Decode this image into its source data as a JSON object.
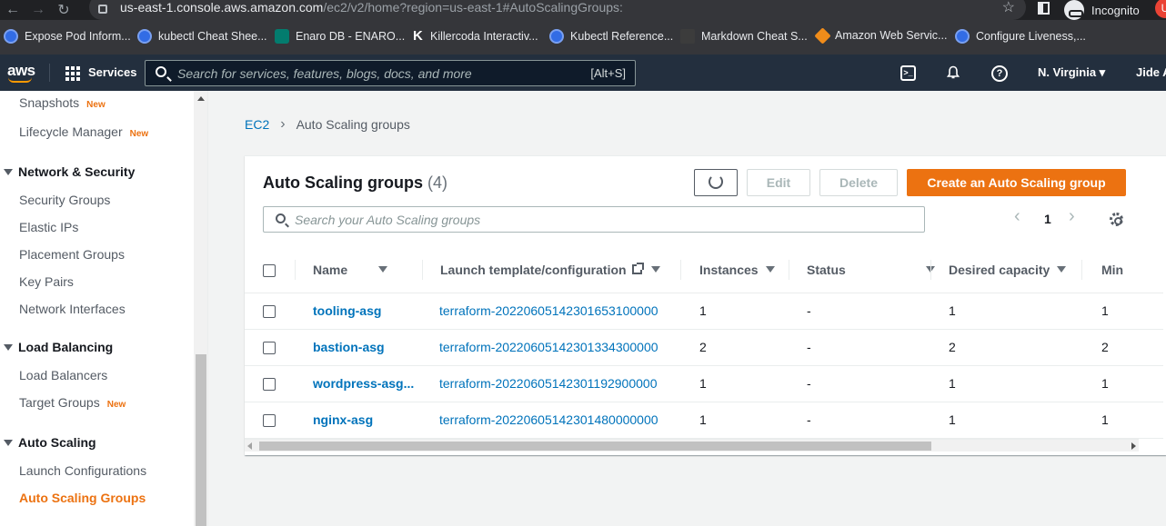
{
  "browser": {
    "url_host": "us-east-1.console.aws.amazon.com",
    "url_rest": "/ec2/v2/home?region=us-east-1#AutoScalingGroups:",
    "incognito_label": "Incognito",
    "profile_initial": "U"
  },
  "bookmarks": [
    {
      "label": "Expose Pod Inform...",
      "icon": "kubernetes-icon"
    },
    {
      "label": "kubectl Cheat Shee...",
      "icon": "kubernetes-icon"
    },
    {
      "label": "Enaro DB - ENARO...",
      "icon": "sharepoint-icon"
    },
    {
      "label": "Killercoda Interactiv...",
      "icon": "killercoda-icon"
    },
    {
      "label": "Kubectl Reference...",
      "icon": "kubernetes-icon"
    },
    {
      "label": "Markdown Cheat S...",
      "icon": "markdown-icon"
    },
    {
      "label": "Amazon Web Servic...",
      "icon": "aws-icon"
    },
    {
      "label": "Configure Liveness,...",
      "icon": "kubernetes-icon"
    }
  ],
  "topnav": {
    "logo": "aws",
    "services": "Services",
    "search_placeholder": "Search for services, features, blogs, docs, and more",
    "search_shortcut": "[Alt+S]",
    "region": "N. Virginia",
    "user": "Jide A"
  },
  "sidebar": {
    "items": [
      {
        "type": "item",
        "label": "Snapshots",
        "badge": "New"
      },
      {
        "type": "item",
        "label": "Lifecycle Manager",
        "badge": "New"
      },
      {
        "type": "section",
        "label": "Network & Security"
      },
      {
        "type": "item",
        "label": "Security Groups"
      },
      {
        "type": "item",
        "label": "Elastic IPs"
      },
      {
        "type": "item",
        "label": "Placement Groups"
      },
      {
        "type": "item",
        "label": "Key Pairs"
      },
      {
        "type": "item",
        "label": "Network Interfaces"
      },
      {
        "type": "section",
        "label": "Load Balancing"
      },
      {
        "type": "item",
        "label": "Load Balancers"
      },
      {
        "type": "item",
        "label": "Target Groups",
        "badge": "New"
      },
      {
        "type": "section",
        "label": "Auto Scaling"
      },
      {
        "type": "item",
        "label": "Launch Configurations"
      },
      {
        "type": "item",
        "label": "Auto Scaling Groups",
        "active": true
      }
    ]
  },
  "breadcrumb": {
    "root": "EC2",
    "current": "Auto Scaling groups"
  },
  "panel": {
    "title": "Auto Scaling groups",
    "count": "(4)",
    "edit": "Edit",
    "delete": "Delete",
    "create": "Create an Auto Scaling group",
    "search_placeholder": "Search your Auto Scaling groups",
    "page": "1"
  },
  "table": {
    "columns": [
      "Name",
      "Launch template/configuration",
      "Instances",
      "Status",
      "Desired capacity",
      "Min"
    ],
    "rows": [
      {
        "name": "tooling-asg",
        "template": "terraform-20220605142301653100000",
        "instances": "1",
        "status": "-",
        "desired": "1",
        "min": "1"
      },
      {
        "name": "bastion-asg",
        "template": "terraform-20220605142301334300000",
        "instances": "2",
        "status": "-",
        "desired": "2",
        "min": "2"
      },
      {
        "name": "wordpress-asg...",
        "template": "terraform-20220605142301192900000",
        "instances": "1",
        "status": "-",
        "desired": "1",
        "min": "1"
      },
      {
        "name": "nginx-asg",
        "template": "terraform-20220605142301480000000",
        "instances": "1",
        "status": "-",
        "desired": "1",
        "min": "1"
      }
    ]
  },
  "colors": {
    "accent": "#ec7211",
    "link": "#0073bb",
    "nav_bg": "#232f3e"
  }
}
